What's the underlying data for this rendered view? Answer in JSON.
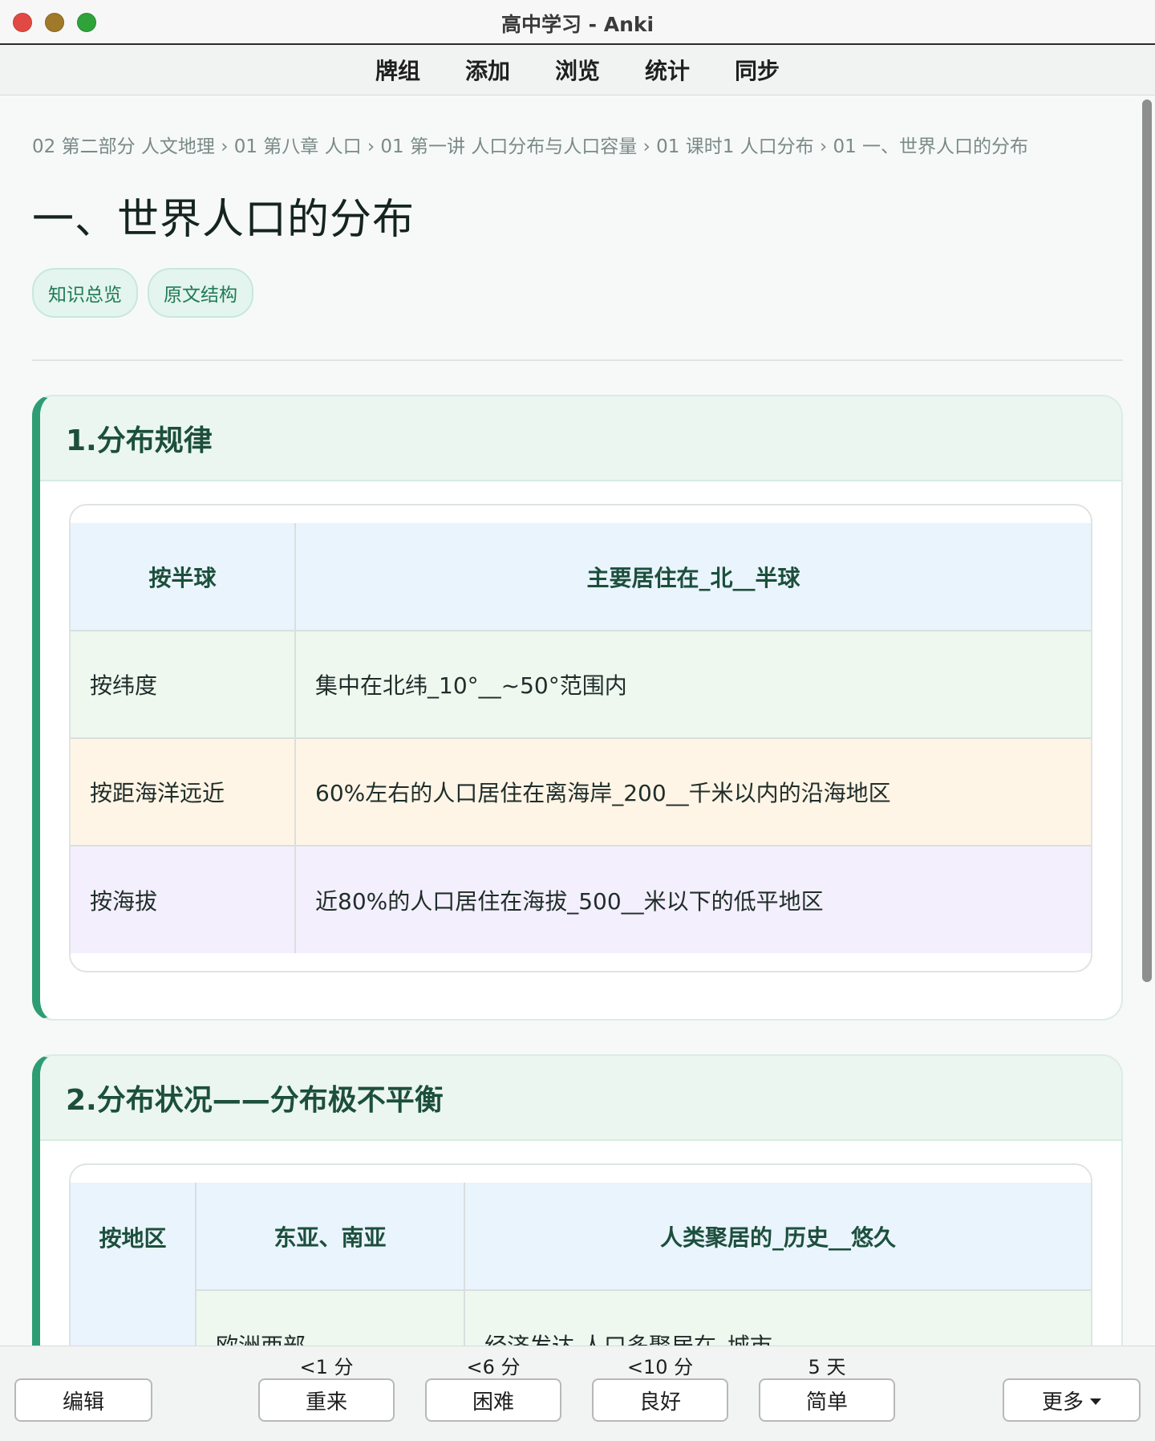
{
  "window": {
    "title": "高中学习 - Anki"
  },
  "toolbar": {
    "items": [
      "牌组",
      "添加",
      "浏览",
      "统计",
      "同步"
    ]
  },
  "breadcrumb": "02 第二部分 人文地理 › 01 第八章 人口 › 01 第一讲 人口分布与人口容量 › 01 课时1 人口分布 › 01 一、世界人口的分布",
  "page_title": "一、世界人口的分布",
  "tags": [
    "知识总览",
    "原文结构"
  ],
  "section1": {
    "title": "1.分布规律",
    "table": {
      "header": [
        "按半球",
        "主要居住在_北__半球"
      ],
      "rows": [
        [
          "按纬度",
          "集中在北纬_10°__~50°范围内"
        ],
        [
          "按距海洋远近",
          "60%左右的人口居住在离海岸_200__千米以内的沿海地区"
        ],
        [
          "按海拔",
          "近80%的人口居住在海拔_500__米以下的低平地区"
        ]
      ]
    }
  },
  "section2": {
    "title": "2.分布状况——分布极不平衡",
    "table": {
      "group_label": "按地区",
      "header": [
        "东亚、南亚",
        "人类聚居的_历史__悠久"
      ],
      "rows": [
        [
          "欧洲西部、",
          "经济发达,人口多聚居在_城市__"
        ]
      ]
    }
  },
  "bottombar": {
    "edit_label": "编辑",
    "answers": [
      {
        "label": "重来",
        "due": "<1 分"
      },
      {
        "label": "困难",
        "due": "<6 分"
      },
      {
        "label": "良好",
        "due": "<10 分"
      },
      {
        "label": "简单",
        "due": "5 天"
      }
    ],
    "more_label": "更多"
  }
}
